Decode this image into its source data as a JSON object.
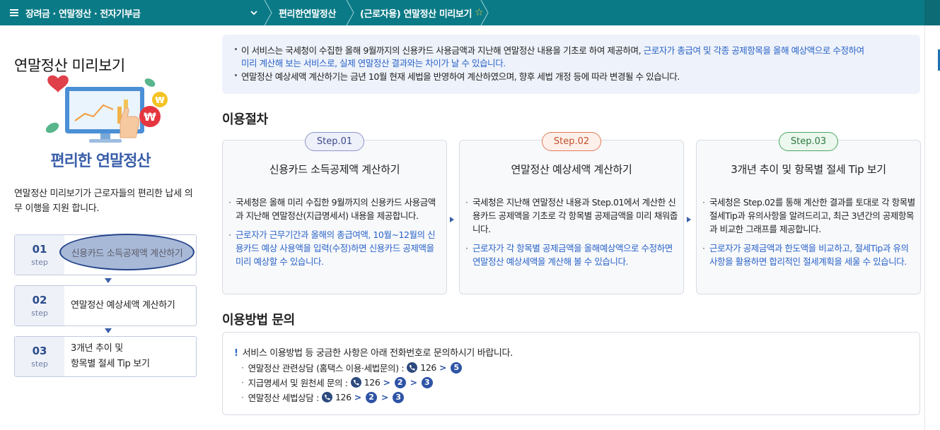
{
  "topbar": {
    "menu_label": "장려금 · 연말정산 · 전자기부금",
    "breadcrumb_1": "편리한연말정산",
    "breadcrumb_2": "(근로자용) 연말정산 미리보기"
  },
  "left": {
    "title": "연말정산 미리보기",
    "hero_caption": "편리한 연말정산",
    "desc": "연말정산 미리보기가 근로자들의  편리한 납세 의무 이행을 지원 합니다.",
    "steps": [
      {
        "num": "01",
        "unit": "step",
        "label": "신용카드 소득공제액 계산하기"
      },
      {
        "num": "02",
        "unit": "step",
        "label": "연말정산 예상세액 계산하기"
      },
      {
        "num": "03",
        "unit": "step",
        "label_line1": "3개년 추이 및",
        "label_line2": "항목별 절세 Tip 보기"
      }
    ]
  },
  "notice": {
    "line1_dark": "이 서비스는 국세청이 수집한 올해 9월까지의 신용카드 사용금액과 지난해 연말정산 내용을 기초로 하여 제공하며, ",
    "line1_blue": "근로자가 총급여 및 각종 공제항목을 올해 예상액으로 수정하여",
    "line2_blue": "미리 계산해 보는 서비스로, 실제 연말정산 결과와는 차이가 날 수 있습니다.",
    "line3": "연말정산 예상세액 계산하기는 금년 10월 현재 세법을 반영하여 계산하였으며, 향후 세법 개정 등에 따라 변경될 수 있습니다."
  },
  "procedure": {
    "heading": "이용절차",
    "cards": [
      {
        "pill": "Step.01",
        "title": "신용카드 소득공제액 계산하기",
        "item1": "국세청은 올해 미리 수집한 9월까지의 신용카드 사용금액과 지난해 연말정산(지급명세서) 내용을 제공합니다.",
        "item2": "근로자가 근무기간과 올해의 총급여액, 10월~12월의 신용카드 예상 사용액을 입력(수정)하면 신용카드 공제액을 미리 예상할 수 있습니다."
      },
      {
        "pill": "Step.02",
        "title": "연말정산 예상세액 계산하기",
        "item1": "국세청은 지난해 연말정산 내용과 Step.01에서 계산한 신용카드 공제액을 기초로 각 항목별 공제금액을 미리 채워줍니다.",
        "item2": "근로자가 각 항목별 공제금액을 올해예상액으로 수정하면 연말정산 예상세액을 계산해 볼 수 있습니다."
      },
      {
        "pill": "Step.03",
        "title": "3개년 추이 및 항목별 절세 Tip 보기",
        "item1": "국세청은 Step.02를 통해 계산한 결과를 토대로 각 항목별 절세Tip과 유의사항을 알려드리고, 최근 3년간의 공제항목과 비교한 그래프를 제공합니다.",
        "item2": "근로자가 공제금액과 한도액을 비교하고, 절세Tip과 유의사항을 활용하면 합리적인 절세계획을 세울 수 있습니다."
      }
    ]
  },
  "inquiry": {
    "heading": "이용방법 문의",
    "lead": "서비스 이용방법 등 궁금한 사항은 아래 전화번호로 문의하시기 바랍니다.",
    "rows": [
      {
        "label": "연말정산 관련상담 (홈택스 이용·세법문의) :",
        "phone": "126",
        "opts": [
          "5"
        ]
      },
      {
        "label": "지급명세서 및 원천세 문의 :",
        "phone": "126",
        "opts": [
          "2",
          "3"
        ]
      },
      {
        "label": "연말정산 세법상담 :",
        "phone": "126",
        "opts": [
          "2",
          "3"
        ]
      }
    ]
  },
  "colors": {
    "topbar": "#0a7a86",
    "accent_blue": "#2a63c8",
    "step1_pill_border": "#8f95c9",
    "step2_pill_border": "#e07a5a",
    "step3_pill_border": "#4aa860"
  }
}
